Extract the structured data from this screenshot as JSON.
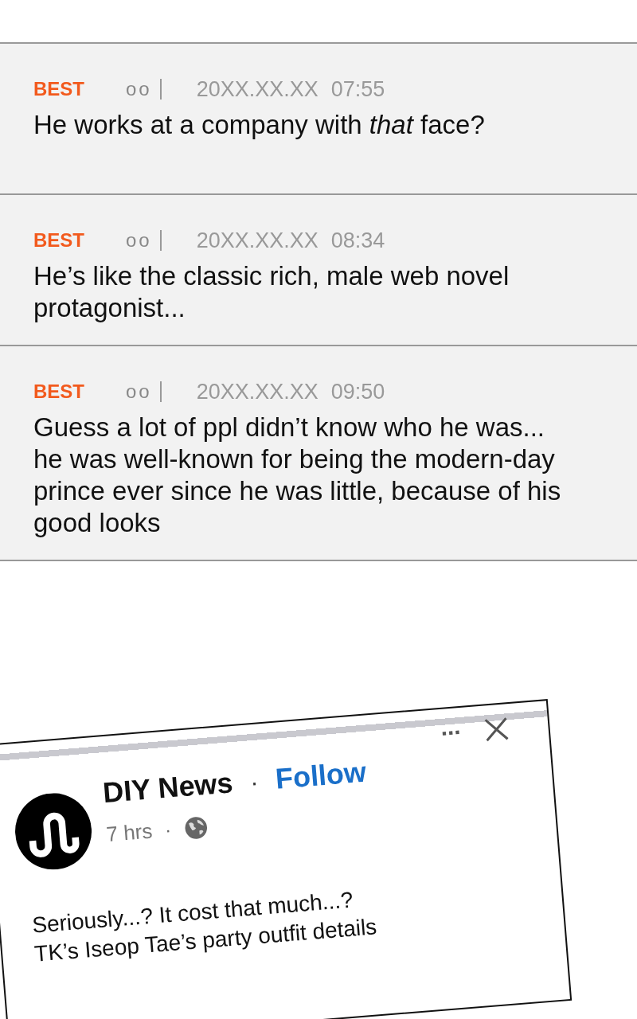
{
  "comments": [
    {
      "badge": "BEST",
      "user": "oo",
      "date": "20XX.XX.XX",
      "time": "07:55",
      "text": "He works at a company with *that* face?"
    },
    {
      "badge": "BEST",
      "user": "oo",
      "date": "20XX.XX.XX",
      "time": "08:34",
      "text": "He’s like the classic rich, male web novel protagonist..."
    },
    {
      "badge": "BEST",
      "user": "oo",
      "date": "20XX.XX.XX",
      "time": "09:50",
      "text": "Guess a lot of ppl didn’t know who he was... he was well-known for being the modern-day prince ever since he was little, because of his good looks"
    }
  ],
  "post": {
    "page_name": "DIY News",
    "separator": "·",
    "follow": "Follow",
    "age": "7 hrs",
    "dot": "·",
    "more": "...",
    "lines": [
      "Seriously...? It cost that much...?",
      "TK’s Iseop Tae’s party outfit details"
    ]
  }
}
